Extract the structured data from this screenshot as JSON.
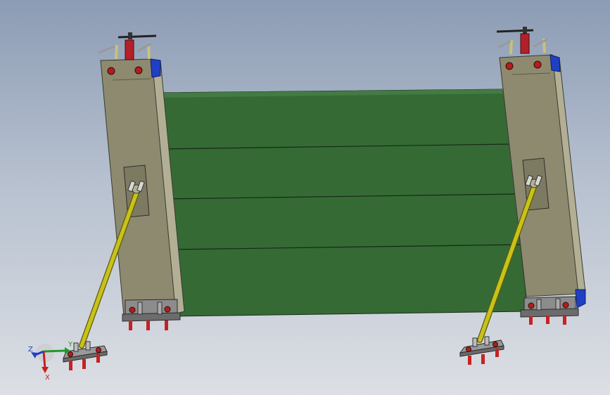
{
  "triad": {
    "x_label": "X",
    "y_label": "Y",
    "z_label": "Z"
  },
  "colors": {
    "background_top": "#8c9cb4",
    "background_bottom": "#dcdfe4",
    "panel": "#356a35",
    "column": "#8d8a70",
    "brace": "#c8c21a",
    "bolt": "#c62222",
    "end_cap": "#1f3fc4",
    "base_plate": "#808080"
  }
}
